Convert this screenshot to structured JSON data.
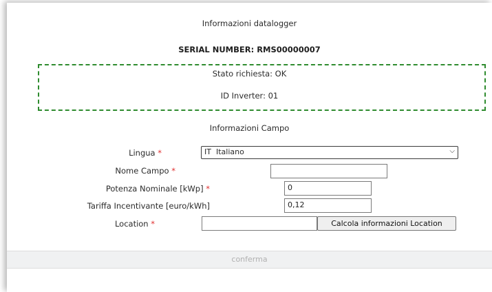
{
  "header": {
    "title": "Informazioni datalogger",
    "serial": "SERIAL NUMBER: RMS00000007"
  },
  "status": {
    "request": "Stato richiesta: OK",
    "inverter": "ID Inverter: 01"
  },
  "campo": {
    "title": "Informazioni Campo",
    "required_mark": "*",
    "lingua": {
      "label": "Lingua",
      "flag": "IT",
      "value": "Italiano"
    },
    "nome": {
      "label": "Nome Campo",
      "value": ""
    },
    "potenza": {
      "label": "Potenza Nominale [kWp]",
      "value": "0"
    },
    "tariffa": {
      "label": "Tariffa Incentivante [euro/kWh]",
      "value": "0,12"
    },
    "location": {
      "label": "Location",
      "value": "",
      "button": "Calcola informazioni Location"
    }
  },
  "footer": {
    "confirm_label": "conferma"
  },
  "colors": {
    "required": "#e03030",
    "status_border": "#2e8b2e"
  }
}
